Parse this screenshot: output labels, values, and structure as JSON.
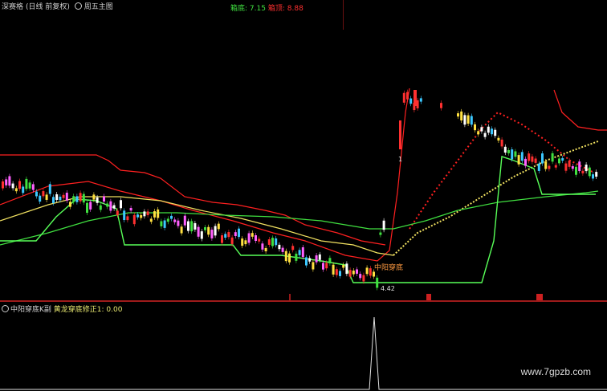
{
  "header": {
    "stock_name": "深赛格",
    "period": "(日线 前复权)",
    "template": "周五主图"
  },
  "readout": {
    "box_low_label": "箱底:",
    "box_low_value": "7.15",
    "box_high_label": "箱顶:",
    "box_high_value": "8.88"
  },
  "annotations": {
    "cross_label": "中阳穿底",
    "low_price": "4.42",
    "marker_1": "1"
  },
  "sub_panel": {
    "title": "中阳穿底K副",
    "indicator": "黄龙穿底修正1: 0.00"
  },
  "watermark": "www.7gpzb.com",
  "colors": {
    "background": "#000000",
    "up_candle": "#ff3030",
    "down_candle": "#3cc8ff",
    "upper_band": "#ff2020",
    "yellow_ma": "#f0e060",
    "green_ma": "#40e040",
    "support": "#58ff58"
  }
}
